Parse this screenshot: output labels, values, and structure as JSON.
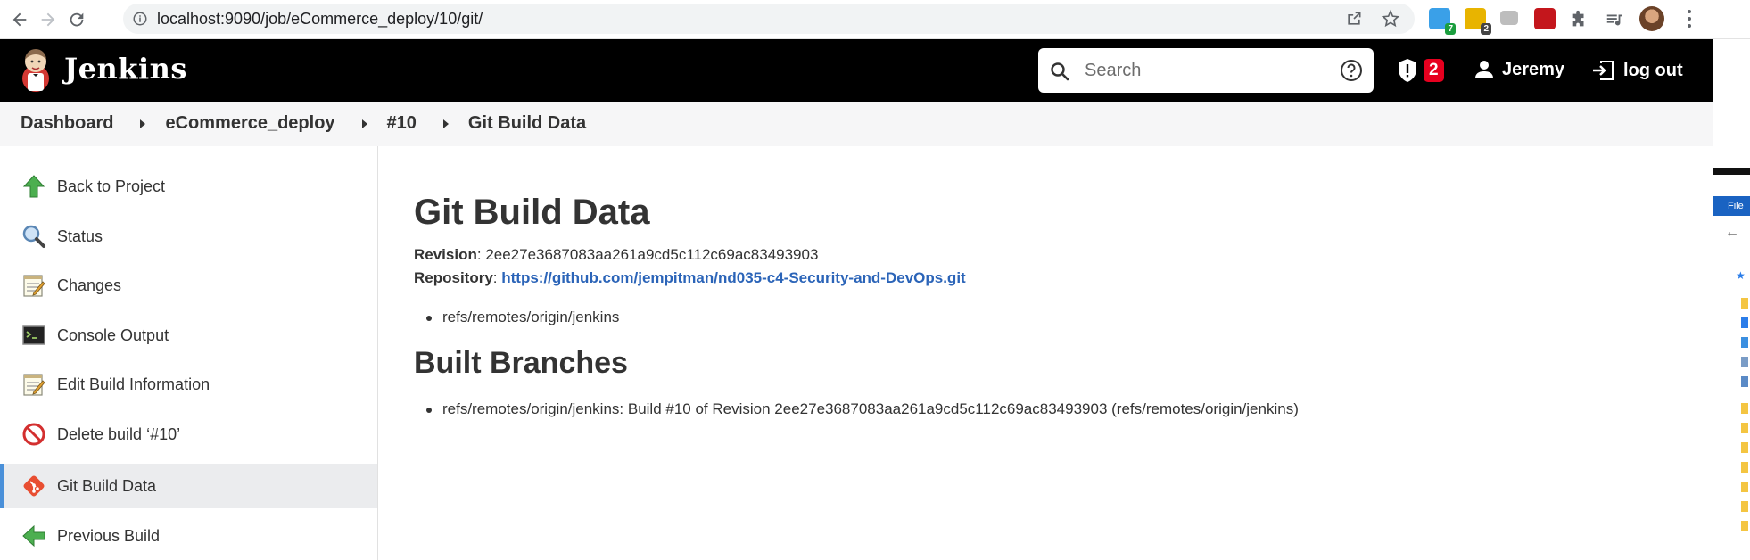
{
  "browser": {
    "url": "localhost:9090/job/eCommerce_deploy/10/git/",
    "extensions": [
      {
        "name": "grammarly-extension-icon",
        "color": "#3aa0e8",
        "count": "7",
        "count_color": "#1b9e3e"
      },
      {
        "name": "toolbar-extension-icon",
        "color": "#e8b400",
        "count": "2",
        "count_color": "#444444"
      },
      {
        "name": "chat-extension-icon",
        "color": "#bdbdbd",
        "count": "",
        "count_color": ""
      },
      {
        "name": "acrobat-extension-icon",
        "color": "#c4161c",
        "count": "",
        "count_color": ""
      }
    ]
  },
  "header": {
    "brand": "Jenkins",
    "search_placeholder": "Search",
    "security_count": "2",
    "user": "Jeremy",
    "logout": "log out"
  },
  "breadcrumb": [
    "Dashboard",
    "eCommerce_deploy",
    "#10",
    "Git Build Data"
  ],
  "sidebar": {
    "items": [
      {
        "label": "Back to Project",
        "icon": "up-arrow-icon",
        "active": false
      },
      {
        "label": "Status",
        "icon": "magnifier-icon",
        "active": false
      },
      {
        "label": "Changes",
        "icon": "notepad-icon",
        "active": false
      },
      {
        "label": "Console Output",
        "icon": "terminal-icon",
        "active": false
      },
      {
        "label": "Edit Build Information",
        "icon": "notepad-icon",
        "active": false
      },
      {
        "label": "Delete build ‘#10’",
        "icon": "no-entry-icon",
        "active": false
      },
      {
        "label": "Git Build Data",
        "icon": "git-icon",
        "active": true
      },
      {
        "label": "Previous Build",
        "icon": "left-arrow-icon",
        "active": false
      }
    ]
  },
  "main": {
    "title": "Git Build Data",
    "revision_label": "Revision",
    "revision_value": "2ee27e3687083aa261a9cd5c112c69ac83493903",
    "repository_label": "Repository",
    "repository_url": "https://github.com/jempitman/nd035-c4-Security-and-DevOps.git",
    "remote_branches": [
      "refs/remotes/origin/jenkins"
    ],
    "built_branches_title": "Built Branches",
    "built_branches": [
      "refs/remotes/origin/jenkins: Build #10 of Revision 2ee27e3687083aa261a9cd5c112c69ac83493903 (refs/remotes/origin/jenkins)"
    ]
  },
  "edge_window": {
    "menu_label": "File"
  },
  "colors": {
    "header_bg": "#000000",
    "breadcrumb_bg": "#f6f6f7",
    "link": "#2b64b8",
    "active_item_bg": "#ebecee",
    "active_item_accent": "#4a90d9",
    "badge": "#e6001f"
  }
}
